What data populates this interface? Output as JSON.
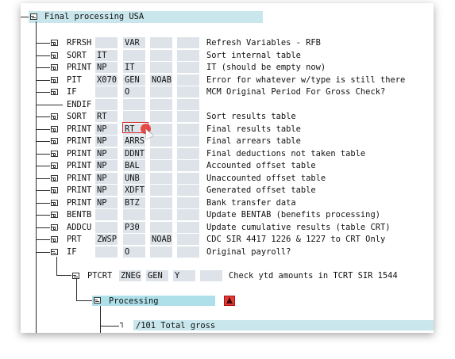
{
  "title": "Final processing USA",
  "rows": [
    {
      "op": "RFRSH",
      "p1": "",
      "p2": "VAR",
      "p3": "",
      "p4": "",
      "desc": "Refresh Variables - RFB"
    },
    {
      "op": "SORT",
      "p1": "IT",
      "p2": "",
      "p3": "",
      "p4": "",
      "desc": "Sort internal table"
    },
    {
      "op": "PRINT",
      "p1": "NP",
      "p2": "IT",
      "p3": "",
      "p4": "",
      "desc": "IT (should be empty now)"
    },
    {
      "op": "PIT",
      "p1": "X070",
      "p2": "GEN",
      "p3": "NOAB",
      "p4": "",
      "desc": "Error for whatever w/type is still there"
    },
    {
      "op": "IF",
      "p1": "",
      "p2": "O",
      "p3": "",
      "p4": "",
      "desc": "MCM Original Period For Gross Check?"
    },
    {
      "op": "ENDIF",
      "p1": "",
      "p2": "",
      "p3": "",
      "p4": "",
      "desc": ""
    },
    {
      "op": "SORT",
      "p1": "RT",
      "p2": "",
      "p3": "",
      "p4": "",
      "desc": "Sort results table"
    },
    {
      "op": "PRINT",
      "p1": "NP",
      "p2": "RT",
      "p3": "",
      "p4": "",
      "desc": "Final results table"
    },
    {
      "op": "PRINT",
      "p1": "NP",
      "p2": "ARRS",
      "p3": "",
      "p4": "",
      "desc": "Final arrears table"
    },
    {
      "op": "PRINT",
      "p1": "NP",
      "p2": "DDNT",
      "p3": "",
      "p4": "",
      "desc": "Final deductions not taken table"
    },
    {
      "op": "PRINT",
      "p1": "NP",
      "p2": "BAL",
      "p3": "",
      "p4": "",
      "desc": "Accounted offset table"
    },
    {
      "op": "PRINT",
      "p1": "NP",
      "p2": "UNB",
      "p3": "",
      "p4": "",
      "desc": "Unaccounted offset table"
    },
    {
      "op": "PRINT",
      "p1": "NP",
      "p2": "XDFT",
      "p3": "",
      "p4": "",
      "desc": "Generated offset table"
    },
    {
      "op": "PRINT",
      "p1": "NP",
      "p2": "BTZ",
      "p3": "",
      "p4": "",
      "desc": "Bank transfer data"
    },
    {
      "op": "BENTB",
      "p1": "",
      "p2": "",
      "p3": "",
      "p4": "",
      "desc": "Update BENTAB (benefits processing)"
    },
    {
      "op": "ADDCU",
      "p1": "",
      "p2": "P30",
      "p3": "",
      "p4": "",
      "desc": "Update cumulative results (table CRT)"
    },
    {
      "op": "PRT",
      "p1": "ZWSP",
      "p2": "",
      "p3": "NOAB",
      "p4": "",
      "desc": "CDC SIR 4417 1226 & 1227 to CRT Only"
    },
    {
      "op": "IF",
      "p1": "",
      "p2": "O",
      "p3": "",
      "p4": "",
      "desc": "Original payroll?"
    }
  ],
  "ptcrt_row": {
    "op": "PTCRT",
    "p1": "ZNEG",
    "p2": "GEN",
    "p3": "Y",
    "p4": "",
    "desc": "Check ytd amounts in TCRT SIR 1544"
  },
  "processing_label": "Processing",
  "total_gross_label": "/101 Total gross",
  "colors": {
    "header_bg": "#c8e6ec",
    "processing_bg": "#aee0ea",
    "cell_bg": "#dde3e8",
    "warn": "#e53935"
  }
}
